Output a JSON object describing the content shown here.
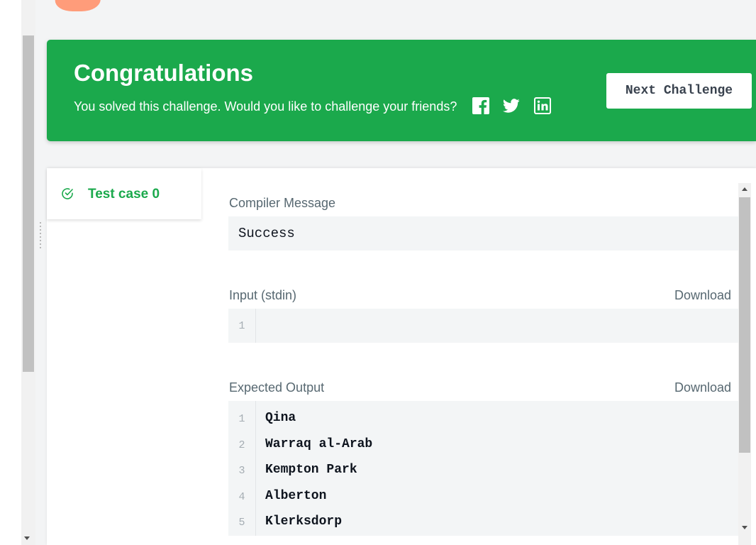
{
  "banner": {
    "title": "Congratulations",
    "text": "You solved this challenge. Would you like to challenge your friends?",
    "share_icons": [
      "facebook-icon",
      "twitter-icon",
      "linkedin-icon"
    ],
    "next_button": "Next Challenge",
    "color": "#1ba94c"
  },
  "test_case": {
    "label": "Test case 0",
    "status_icon": "check-circle-icon"
  },
  "compiler": {
    "label": "Compiler Message",
    "message": "Success"
  },
  "input": {
    "label": "Input (stdin)",
    "download": "Download",
    "lines": [
      {
        "n": "1",
        "text": ""
      }
    ]
  },
  "expected": {
    "label": "Expected Output",
    "download": "Download",
    "lines": [
      {
        "n": "1",
        "text": "Qina"
      },
      {
        "n": "2",
        "text": "Warraq al-Arab"
      },
      {
        "n": "3",
        "text": "Kempton Park"
      },
      {
        "n": "4",
        "text": "Alberton"
      },
      {
        "n": "5",
        "text": "Klerksdorp"
      }
    ]
  }
}
